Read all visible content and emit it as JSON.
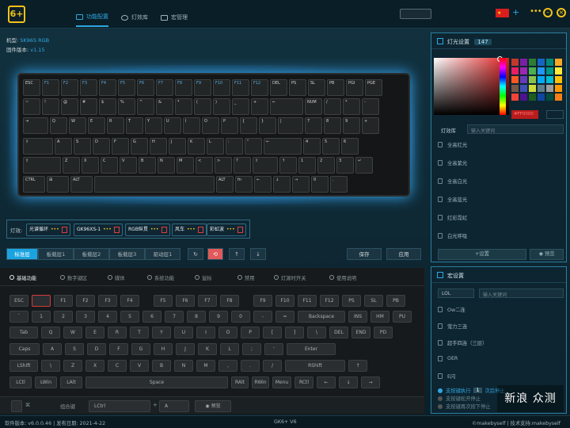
{
  "header": {
    "logo": "6+",
    "tabs": [
      {
        "label": "功能配置"
      },
      {
        "label": "灯效库"
      },
      {
        "label": "宏管理"
      }
    ],
    "more": "•••"
  },
  "device": {
    "model_label": "机型:",
    "model": "SK96S RGB",
    "firmware_label": "固件版本:",
    "firmware": "v1.15"
  },
  "keyboard": {
    "rows": [
      [
        "ESC",
        "F1",
        "F2",
        "F3",
        "F4",
        "F5",
        "F6",
        "F7",
        "F8",
        "F9",
        "F10",
        "F11",
        "F12",
        "DEL",
        "PS",
        "SL",
        "PB",
        "PGI",
        "PGE"
      ],
      [
        "~",
        "!",
        "@",
        "#",
        "$",
        "%",
        "^",
        "&",
        "*",
        "(",
        ")",
        "_",
        "+",
        "←",
        "NUM",
        "/",
        "*",
        "-"
      ],
      [
        "⇥",
        "Q",
        "W",
        "E",
        "R",
        "T",
        "Y",
        "U",
        "I",
        "O",
        "P",
        "{",
        "}",
        "|",
        "7",
        "8",
        "9",
        "+"
      ],
      [
        "⇪",
        "A",
        "S",
        "D",
        "F",
        "G",
        "H",
        "J",
        "K",
        "L",
        ":",
        "\"",
        "←",
        "4",
        "5",
        "6"
      ],
      [
        "⇧",
        "Z",
        "X",
        "C",
        "V",
        "B",
        "N",
        "M",
        "<",
        ">",
        "?",
        "⇧",
        "↑",
        "1",
        "2",
        "3",
        "↵"
      ],
      [
        "CTRL",
        "⊞",
        "ALT",
        "",
        "ALT",
        "fn",
        "←",
        "↓",
        "→",
        "0",
        "."
      ]
    ]
  },
  "light_slots": {
    "label": "灯效:",
    "items": [
      {
        "name": "光谱循环",
        "dots": "•••"
      },
      {
        "name": "GK96XS-1",
        "dots": "•••"
      },
      {
        "name": "RGB纵贯",
        "dots": "•••"
      },
      {
        "name": "风车",
        "dots": "•••"
      },
      {
        "name": "彩虹波",
        "dots": "•••"
      }
    ]
  },
  "layers": [
    {
      "label": "标准层"
    },
    {
      "label": "板载层1"
    },
    {
      "label": "板载层2"
    },
    {
      "label": "板载层3"
    },
    {
      "label": "驱动层1"
    }
  ],
  "layer_tools": [
    "↻",
    "⟲",
    "↑",
    "↓"
  ],
  "actions": {
    "save": "保存",
    "apply": "应用"
  },
  "func_tabs": [
    {
      "label": "基础功能"
    },
    {
      "label": "数字键区"
    },
    {
      "label": "媒体"
    },
    {
      "label": "系统功能"
    },
    {
      "label": "鼠标"
    },
    {
      "label": "禁用"
    },
    {
      "label": "灯源时开关"
    },
    {
      "label": "使用说明"
    }
  ],
  "virtual_keys": [
    [
      "ESC",
      "",
      "F1",
      "F2",
      "F3",
      "F4",
      "F5",
      "F6",
      "F7",
      "F8",
      "F9",
      "F10",
      "F11",
      "F12",
      "PS",
      "SL",
      "PB"
    ],
    [
      "`",
      "1",
      "2",
      "3",
      "4",
      "5",
      "6",
      "7",
      "8",
      "9",
      "0",
      "-",
      "=",
      "Backspace",
      "INS",
      "HM",
      "PU"
    ],
    [
      "Tab",
      "Q",
      "W",
      "E",
      "R",
      "T",
      "Y",
      "U",
      "I",
      "O",
      "P",
      "[",
      "]",
      "\\",
      "DEL",
      "END",
      "PD"
    ],
    [
      "Caps",
      "A",
      "S",
      "D",
      "F",
      "G",
      "H",
      "J",
      "K",
      "L",
      ";",
      "'",
      "Enter"
    ],
    [
      "LShift",
      "\\",
      "Z",
      "X",
      "C",
      "V",
      "B",
      "N",
      "M",
      ",",
      ".",
      "/",
      "RShift",
      "↑"
    ],
    [
      "LCtl",
      "LWin",
      "LAlt",
      "Space",
      "RAlt",
      "RWin",
      "Menu",
      "RCtl",
      "←",
      "↓",
      "→"
    ]
  ],
  "combo": {
    "label": "组合键",
    "select": "LCtrl",
    "plus": "+",
    "key": "A",
    "preview": "预览"
  },
  "light_panel": {
    "title": "灯光设置",
    "count": "147",
    "hex": "#FF0000",
    "subtabs": [
      "灯效库",
      "输入关键词"
    ],
    "items": [
      "全高红光",
      "全高紫光",
      "全高白光",
      "全高蓝光",
      "红彩霓虹",
      "白光呼吸"
    ],
    "btn_set": "+设置",
    "btn_preview": "预览",
    "swatches": [
      "#c0392b",
      "#7b1fa2",
      "#2e7d32",
      "#1565c0",
      "#00897b",
      "#f9a825",
      "#e91e63",
      "#9c27b0",
      "#4caf50",
      "#2196f3",
      "#009688",
      "#ffeb3b",
      "#ff5722",
      "#673ab7",
      "#8bc34a",
      "#03a9f4",
      "#00bcd4",
      "#ffc107",
      "#795548",
      "#3f51b5",
      "#cddc39",
      "#607d8b",
      "#9e9e9e",
      "#ff9800",
      "#f44336",
      "#4a148c",
      "#1b5e20",
      "#0d47a1",
      "#004d40",
      "#f57f17"
    ]
  },
  "macro_panel": {
    "title": "宏设置",
    "select": "LOL",
    "search": "输入关键词",
    "items": [
      "Ow二连",
      "萤力三连",
      "超手四连（三层）",
      "OER",
      "E闪"
    ],
    "options": [
      "支按键执行",
      "支按键松开停止",
      "支按键再次按下停止"
    ],
    "option_suffix": "次后停止",
    "count": "1"
  },
  "footer": {
    "left": "软件版本: v6.0.0.46 | 发布日期: 2021-4-22",
    "center": "GK6+ V6",
    "right": "©makebyself | 技术支持:makebyself"
  },
  "watermark": "新浪 众测"
}
